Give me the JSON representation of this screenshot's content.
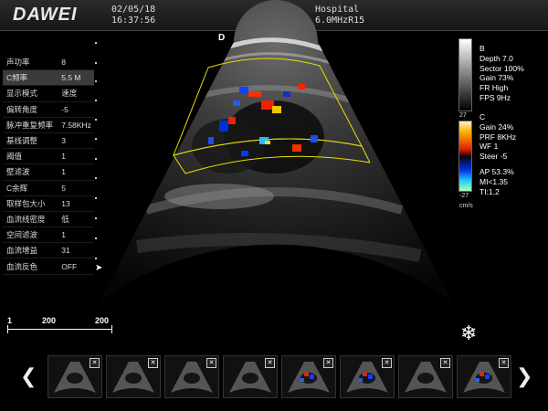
{
  "header": {
    "logo": "DAWEI",
    "date": "02/05/18",
    "time": "16:37:56",
    "hospital": "Hospital",
    "probe": "6.0MHzR15"
  },
  "params": [
    {
      "label": "声功率",
      "value": "8"
    },
    {
      "label": "C频率",
      "value": "5.5 M"
    },
    {
      "label": "显示模式",
      "value": "速度"
    },
    {
      "label": "偏转角度",
      "value": "-5"
    },
    {
      "label": "脉冲重复频率",
      "value": "7.58KHz"
    },
    {
      "label": "基线调整",
      "value": "3"
    },
    {
      "label": "阈值",
      "value": "1"
    },
    {
      "label": "壁滤波",
      "value": "1"
    },
    {
      "label": "C余辉",
      "value": "5"
    },
    {
      "label": "取样包大小",
      "value": "13"
    },
    {
      "label": "血流线密度",
      "value": "低"
    },
    {
      "label": "空间滤波",
      "value": "1"
    },
    {
      "label": "血流增益",
      "value": "31"
    },
    {
      "label": "血流反色",
      "value": "OFF"
    }
  ],
  "image": {
    "orientation_mark": "D"
  },
  "b_info": [
    "B",
    "Depth 7.0",
    "Sector 100%",
    "Gain 73%",
    "FR High",
    "FPS 9Hz"
  ],
  "c_info": [
    "C",
    "Gain  24%",
    "PRF 8KHz",
    "WF 1",
    "Steer -5"
  ],
  "safety": [
    "AP 53.3%",
    "MI<1.35",
    "TI:1.2"
  ],
  "colorbar": {
    "top": "27",
    "bottom": "-27",
    "unit": "cm/s"
  },
  "scale": {
    "left": "1",
    "mid": "200",
    "right": "200"
  },
  "icons": {
    "freeze": "snowflake-icon",
    "prev": "chevron-left-icon",
    "next": "chevron-right-icon"
  },
  "thumbnails": [
    {
      "type": "b"
    },
    {
      "type": "b"
    },
    {
      "type": "b"
    },
    {
      "type": "b"
    },
    {
      "type": "color"
    },
    {
      "type": "color"
    },
    {
      "type": "b"
    },
    {
      "type": "color"
    }
  ]
}
